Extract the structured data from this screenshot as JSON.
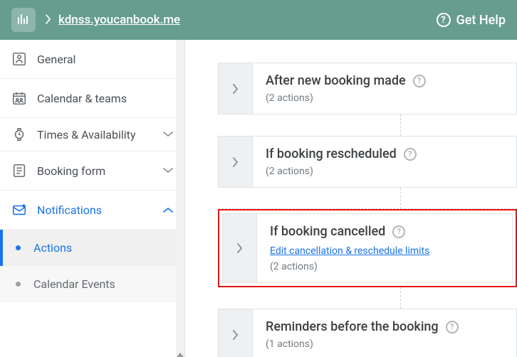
{
  "header": {
    "breadcrumb": "kdnss.youcanbook.me",
    "help": "Get Help"
  },
  "sidebar": {
    "items": [
      {
        "label": "General"
      },
      {
        "label": "Calendar & teams"
      },
      {
        "label": "Times & Availability"
      },
      {
        "label": "Booking form"
      },
      {
        "label": "Notifications"
      }
    ],
    "sub": [
      {
        "label": "Actions"
      },
      {
        "label": "Calendar Events"
      }
    ]
  },
  "cards": {
    "c0": {
      "title": "After new booking made",
      "meta": "(2 actions)"
    },
    "c1": {
      "title": "If booking rescheduled",
      "meta": "(2 actions)"
    },
    "c2": {
      "title": "If booking cancelled",
      "link": "Edit cancellation & reschedule limits",
      "meta": "(2 actions)"
    },
    "c3": {
      "title": "Reminders before the booking",
      "meta": "(1 actions)"
    }
  }
}
